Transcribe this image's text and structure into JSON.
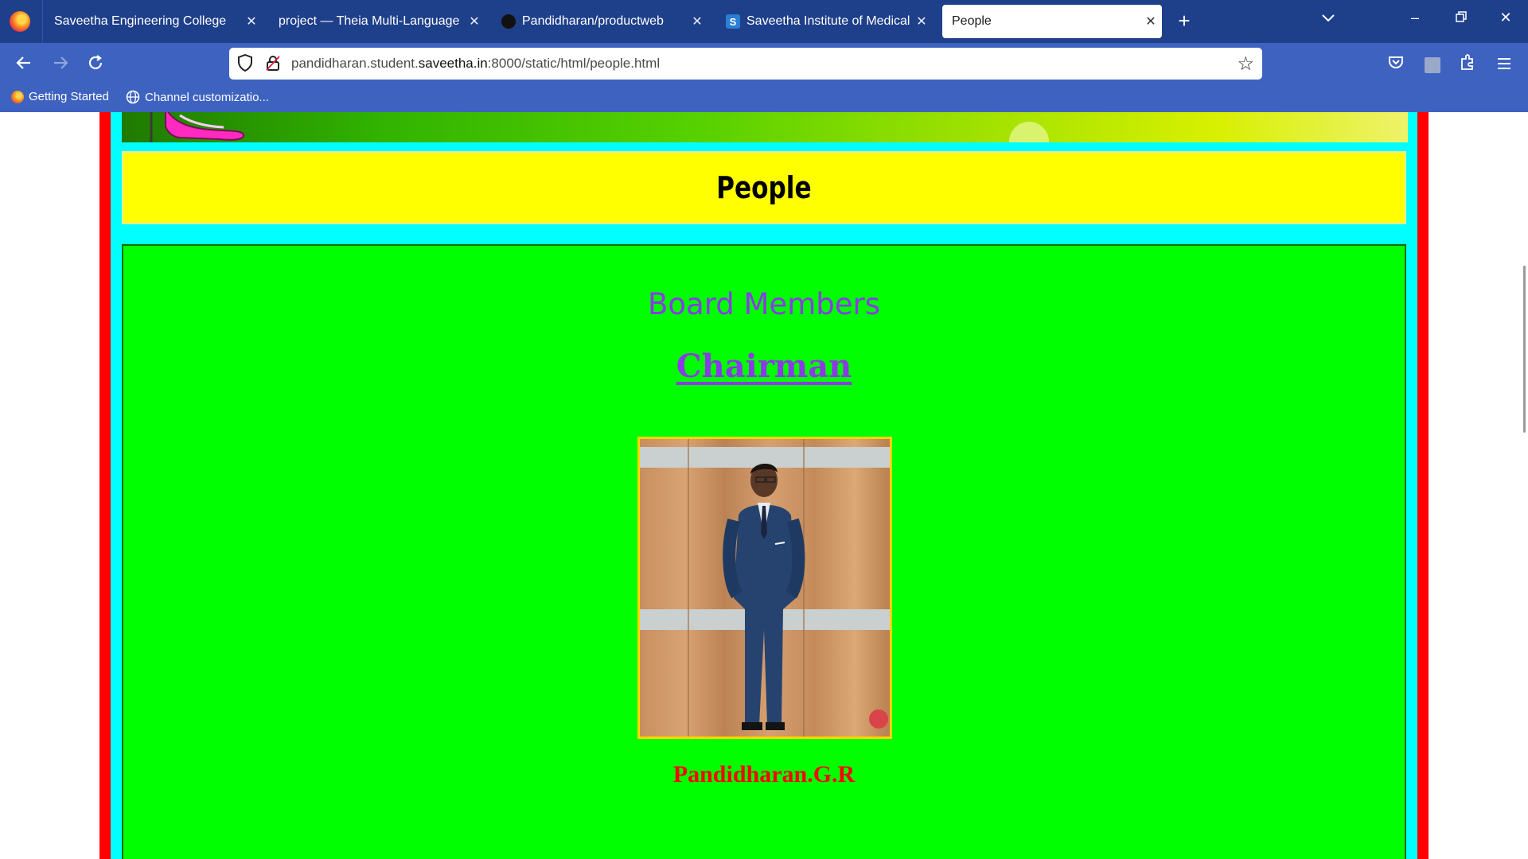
{
  "browser": {
    "tabs": [
      {
        "title": "Saveetha Engineering College",
        "icon": "firefox-tab-icon",
        "active": false
      },
      {
        "title": "project — Theia Multi-Language Ex",
        "icon": "none",
        "active": false
      },
      {
        "title": "Pandidharan/productweb",
        "icon": "github-icon",
        "active": false
      },
      {
        "title": "Saveetha Institute of Medical A",
        "icon": "saveetha-s-icon",
        "s_letter": "S",
        "active": false
      },
      {
        "title": "People",
        "icon": "none",
        "active": true
      }
    ],
    "url": {
      "prefix": "pandidharan.student.",
      "domain": "saveetha.in",
      "suffix": ":8000/static/html/people.html"
    },
    "bookmarks": [
      {
        "label": "Getting Started",
        "icon": "firefox-icon"
      },
      {
        "label": "Channel customizatio...",
        "icon": "globe-icon"
      }
    ],
    "colors": {
      "tabbar": "#1e3f8a",
      "toolbar": "#3d62c0"
    }
  },
  "page": {
    "title": "People",
    "section_heading": "Board Members",
    "role_heading": "Chairman",
    "person_name": "Pandidharan.G.R",
    "colors": {
      "frame": "#ff0000",
      "inner_frame": "#00ffff",
      "title_bg": "#ffff00",
      "panel_bg": "#00ff00",
      "heading": "#8a3be6",
      "name": "#ff0000"
    }
  }
}
